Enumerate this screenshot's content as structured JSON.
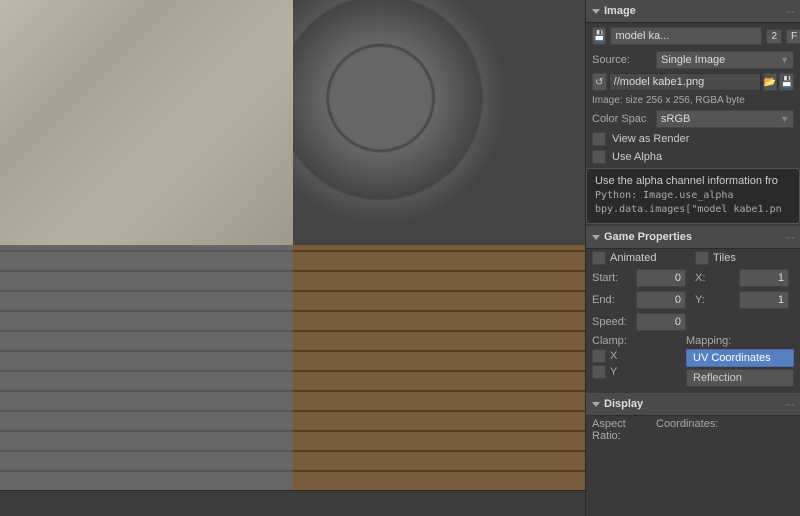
{
  "image_section": {
    "title": "Image",
    "toolbar": {
      "save_btn": "💾",
      "name": "model ka...",
      "number": "2",
      "flag": "F",
      "copy_btn": "⧉",
      "close_btn": "✕"
    },
    "source_label": "Source:",
    "source_value": "Single Image",
    "filepath_icon": "📁",
    "filepath": "//model kabe1.png",
    "save_icon": "💾",
    "open_icon": "📂",
    "info": "Image: size 256 x 256, RGBA byte",
    "color_space_label": "Color Spac",
    "color_space_value": "sRGB",
    "view_as_render_label": "View as Render",
    "use_alpha_label": "Use Alpha",
    "tooltip": {
      "header": "Use the alpha channel information fro",
      "line1": "Python: Image.use_alpha",
      "line2": "bpy.data.images[\"model kabe1.pn"
    }
  },
  "game_properties": {
    "title": "Game Properties",
    "animated_label": "Animated",
    "tiles_label": "Tiles",
    "start_label": "Start:",
    "start_value": "0",
    "x_label": "X:",
    "x_value": "1",
    "end_label": "End:",
    "end_value": "0",
    "y_label": "Y:",
    "y_value": "1",
    "speed_label": "Speed:",
    "speed_value": "0",
    "clamp_label": "Clamp:",
    "mapping_label": "Mapping:",
    "x_check": "X",
    "y_check": "Y",
    "uv_coordinates": "UV Coordinates",
    "reflection": "Reflection"
  },
  "display_section": {
    "title": "Display",
    "aspect_ratio_label": "Aspect Ratio:",
    "coordinates_label": "Coordinates:"
  }
}
